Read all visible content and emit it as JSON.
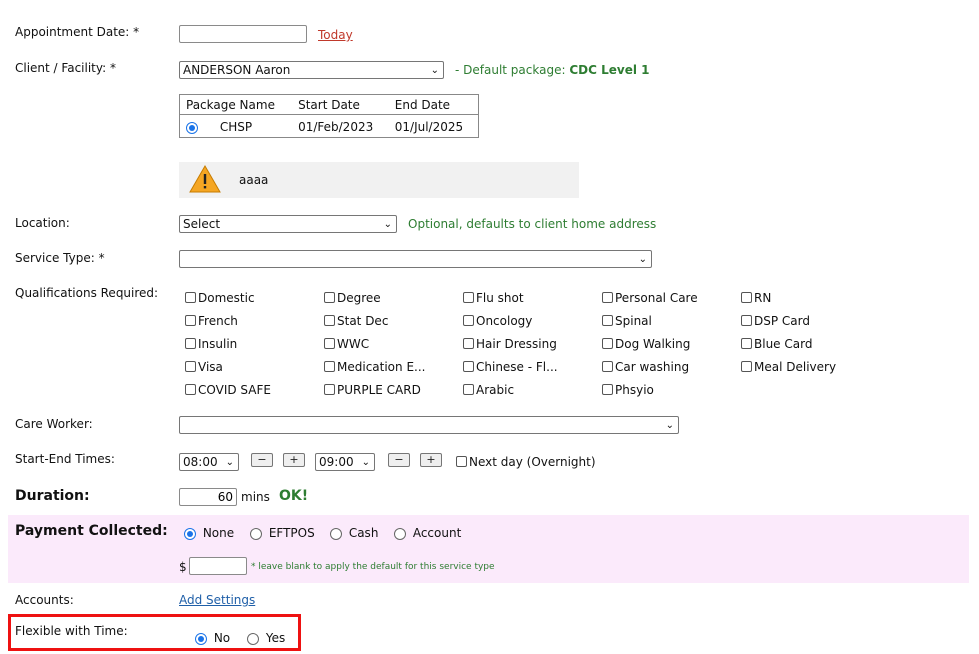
{
  "appointment_date": {
    "label": "Appointment Date: *",
    "value": "",
    "today_link": "Today"
  },
  "client": {
    "label": "Client / Facility: *",
    "selected": "ANDERSON Aaron",
    "default_package_prefix": "- Default package: ",
    "default_package_value": "CDC Level 1"
  },
  "package_table": {
    "headers": [
      "Package Name",
      "Start Date",
      "End Date"
    ],
    "rows": [
      {
        "name": "CHSP",
        "start": "01/Feb/2023",
        "end": "01/Jul/2025"
      }
    ]
  },
  "warning": {
    "text": "aaaa",
    "icon": "warning-icon"
  },
  "location": {
    "label": "Location:",
    "selected": "Select",
    "hint": "Optional, defaults to client home address"
  },
  "service_type": {
    "label": "Service Type: *",
    "selected": ""
  },
  "qualifications": {
    "label": "Qualifications Required:",
    "items": [
      [
        "Domestic",
        "Degree",
        "Flu shot",
        "Personal Care",
        "RN"
      ],
      [
        "French",
        "Stat Dec",
        "Oncology",
        "Spinal",
        "DSP Card"
      ],
      [
        "Insulin",
        "WWC",
        "Hair Dressing",
        "Dog Walking",
        "Blue Card"
      ],
      [
        "Visa",
        "Medication E...",
        "Chinese - Fl...",
        "Car washing",
        "Meal Delivery"
      ],
      [
        "COVID SAFE",
        "PURPLE CARD",
        "Arabic",
        "Phsyio"
      ]
    ]
  },
  "care_worker": {
    "label": "Care Worker:",
    "selected": ""
  },
  "times": {
    "label": "Start-End Times:",
    "start": "08:00",
    "end": "09:00",
    "minus": "−",
    "plus": "+",
    "next_day": "Next day (Overnight)"
  },
  "duration": {
    "label": "Duration:",
    "value": "60",
    "unit": "mins",
    "status": "OK!"
  },
  "payment": {
    "label": "Payment Collected:",
    "options": [
      "None",
      "EFTPOS",
      "Cash",
      "Account"
    ],
    "selected": "None",
    "currency": "$",
    "amount": "",
    "note": "* leave blank to apply the default for this service type"
  },
  "accounts": {
    "label": "Accounts:",
    "link": "Add Settings"
  },
  "flexible": {
    "label": "Flexible with Time:",
    "options": [
      "No",
      "Yes"
    ],
    "selected": "No"
  },
  "colors": {
    "green": "#2e7d32",
    "link_red": "#c0392b",
    "link_blue": "#1f5fa8",
    "payment_bg": "#fbeafb",
    "highlight": "#ee1111",
    "radio_selected": "#1a73e8"
  }
}
